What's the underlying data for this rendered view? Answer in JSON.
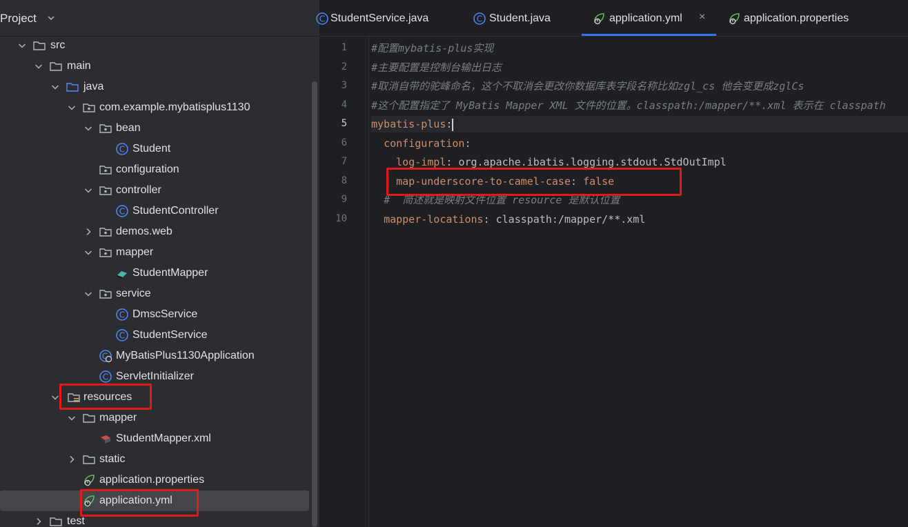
{
  "project": {
    "title": "Project",
    "tree": [
      {
        "label": "src",
        "type": "folder",
        "expanded": true
      },
      {
        "label": "main",
        "type": "folder",
        "expanded": true
      },
      {
        "label": "java",
        "type": "source-folder",
        "expanded": true
      },
      {
        "label": "com.example.mybatisplus1130",
        "type": "package",
        "expanded": true
      },
      {
        "label": "bean",
        "type": "package",
        "expanded": true
      },
      {
        "label": "Student",
        "type": "class"
      },
      {
        "label": "configuration",
        "type": "package"
      },
      {
        "label": "controller",
        "type": "package",
        "expanded": true
      },
      {
        "label": "StudentController",
        "type": "class"
      },
      {
        "label": "demos.web",
        "type": "package",
        "expanded": false
      },
      {
        "label": "mapper",
        "type": "package",
        "expanded": true
      },
      {
        "label": "StudentMapper",
        "type": "mapper"
      },
      {
        "label": "service",
        "type": "package",
        "expanded": true
      },
      {
        "label": "DmscService",
        "type": "class"
      },
      {
        "label": "StudentService",
        "type": "class"
      },
      {
        "label": "MyBatisPlus1130Application",
        "type": "spring-class"
      },
      {
        "label": "ServletInitializer",
        "type": "class"
      },
      {
        "label": "resources",
        "type": "resources-folder",
        "expanded": true
      },
      {
        "label": "mapper",
        "type": "folder",
        "expanded": true
      },
      {
        "label": "StudentMapper.xml",
        "type": "xml"
      },
      {
        "label": "static",
        "type": "folder",
        "expanded": false
      },
      {
        "label": "application.properties",
        "type": "spring-config"
      },
      {
        "label": "application.yml",
        "type": "spring-config",
        "selected": true
      },
      {
        "label": "test",
        "type": "folder",
        "expanded": false
      }
    ]
  },
  "editor": {
    "tabs": [
      {
        "label": "StudentService.java",
        "icon": "class-icon"
      },
      {
        "label": "Student.java",
        "icon": "class-icon"
      },
      {
        "label": "application.yml",
        "icon": "spring-config-icon",
        "active": true,
        "close": "×"
      },
      {
        "label": "application.properties",
        "icon": "spring-config-icon"
      }
    ],
    "line_numbers": [
      "1",
      "2",
      "3",
      "4",
      "5",
      "6",
      "7",
      "8",
      "9",
      "10"
    ],
    "current_line": 5,
    "lines": [
      {
        "kind": "comment",
        "text": "#配置mybatis-plus实现"
      },
      {
        "kind": "comment",
        "text": "#主要配置是控制台输出日志"
      },
      {
        "kind": "comment",
        "text": "#取消自带的驼峰命名，这个不取消会更改你数据库表字段名称比如zgl_cs 他会变更成zglCs"
      },
      {
        "kind": "comment",
        "text": "#这个配置指定了 MyBatis Mapper XML 文件的位置。classpath:/mapper/**.xml 表示在 classpath"
      },
      {
        "kind": "kv",
        "indent": "",
        "key": "mybatis-plus",
        "sep": ":",
        "value": ""
      },
      {
        "kind": "kv",
        "indent": "  ",
        "key": "configuration",
        "sep": ":",
        "value": ""
      },
      {
        "kind": "kv",
        "indent": "    ",
        "key": "log-impl",
        "sep": ": ",
        "value": "org.apache.ibatis.logging.stdout.StdOutImpl"
      },
      {
        "kind": "kv",
        "indent": "    ",
        "key": "map-underscore-to-camel-case",
        "sep": ": ",
        "value": "false"
      },
      {
        "kind": "comment",
        "indent": "  ",
        "text": "#  简述就是映射文件位置 resource 是默认位置"
      },
      {
        "kind": "kv",
        "indent": "  ",
        "key": "mapper-locations",
        "sep": ": ",
        "value": "classpath:/mapper/**.xml"
      }
    ]
  },
  "colors": {
    "highlight_box": "#e11b1b",
    "yaml_key": "#cf8e6d",
    "comment": "#7a7e85",
    "active_tab_underline": "#3574f0"
  }
}
